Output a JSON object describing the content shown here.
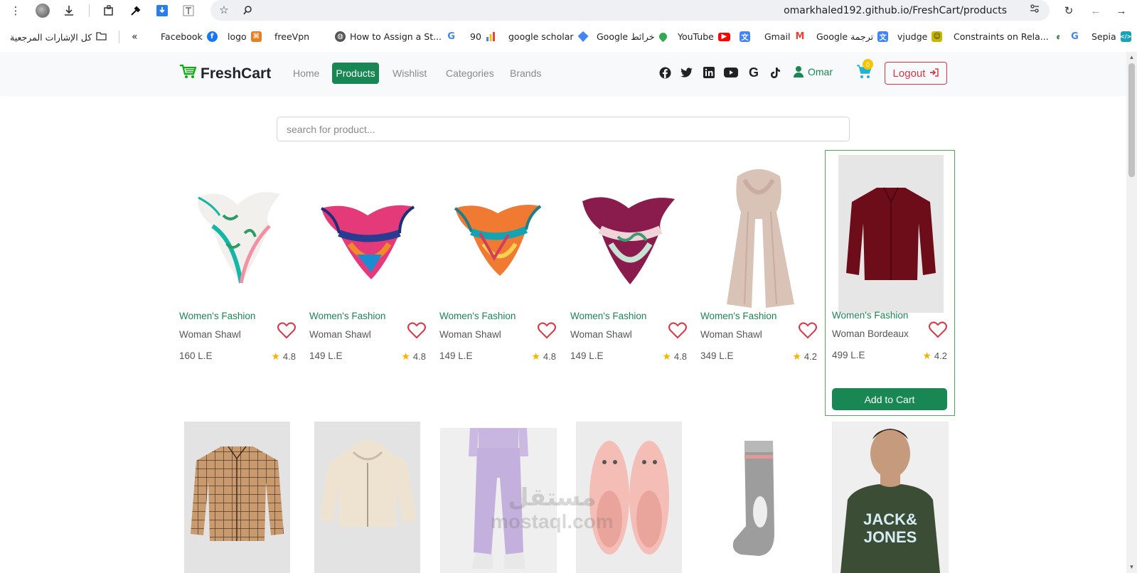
{
  "browser": {
    "url": "omarkhaled192.github.io/FreshCart/products",
    "bookmarks": [
      {
        "label": "كل الإشارات المرجعية"
      },
      {
        "label": "Facebook"
      },
      {
        "label": "logo"
      },
      {
        "label": "freeVpn"
      },
      {
        "label": "How to Assign a St..."
      },
      {
        "label": "90"
      },
      {
        "label": "google scholar"
      },
      {
        "label": "Google خرائط"
      },
      {
        "label": "YouTube"
      },
      {
        "label": "Gmail"
      },
      {
        "label": "Google ترجمة"
      },
      {
        "label": "vjudge"
      },
      {
        "label": "Constraints on Rela..."
      },
      {
        "label": "Sepia"
      }
    ]
  },
  "navbar": {
    "brand": "FreshCart",
    "links": [
      "Home",
      "Products",
      "Wishlist",
      "Categories",
      "Brands"
    ],
    "active": "Products",
    "user": "Omar",
    "cart_count": "0",
    "logout": "Logout"
  },
  "search": {
    "placeholder": "search for product..."
  },
  "products": [
    {
      "category": "Women's Fashion",
      "title": "Woman Shawl",
      "price": "160 L.E",
      "rating": "4.8"
    },
    {
      "category": "Women's Fashion",
      "title": "Woman Shawl",
      "price": "149 L.E",
      "rating": "4.8"
    },
    {
      "category": "Women's Fashion",
      "title": "Woman Shawl",
      "price": "149 L.E",
      "rating": "4.8"
    },
    {
      "category": "Women's Fashion",
      "title": "Woman Shawl",
      "price": "149 L.E",
      "rating": "4.8"
    },
    {
      "category": "Women's Fashion",
      "title": "Woman Shawl",
      "price": "349 L.E",
      "rating": "4.2"
    },
    {
      "category": "Women's Fashion",
      "title": "Woman Bordeaux",
      "price": "499 L.E",
      "rating": "4.2"
    }
  ],
  "add_to_cart": "Add to Cart",
  "watermark": {
    "line1": "مستقل",
    "line2": "mostaql.com"
  },
  "colors": {
    "brand_green": "#198754",
    "logout_red": "#dc3545",
    "cart_cyan": "#1fb3d4",
    "badge_yellow": "#f5c500"
  }
}
